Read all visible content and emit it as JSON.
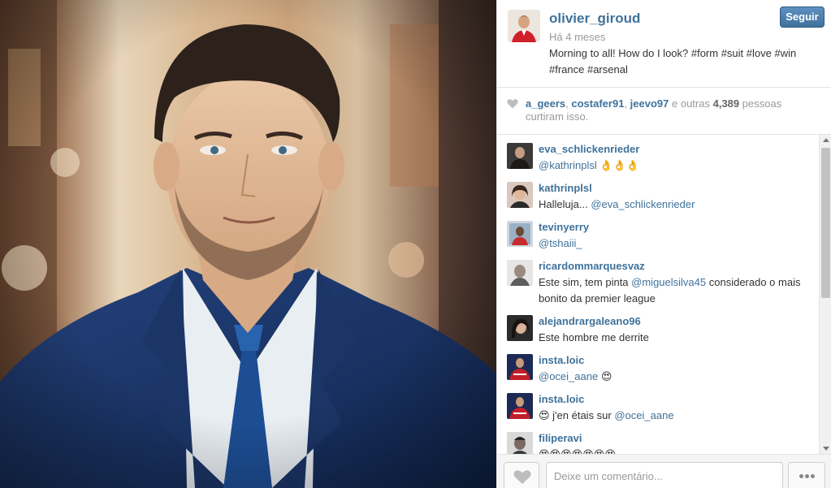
{
  "post": {
    "username": "olivier_giroud",
    "time": "Há 4 meses",
    "caption": "Morning to all! How do I look? #form #suit #love #win #france #arsenal",
    "follow_label": "Seguir"
  },
  "likes": {
    "users": [
      "a_geers",
      "costafer91",
      "jeevo97"
    ],
    "middle_text": "e outras",
    "count": "4,389",
    "tail_text": "pessoas curtiram isso."
  },
  "comments": [
    {
      "user": "eva_schlickenrieder",
      "parts": [
        {
          "t": "@kathrinplsl",
          "m": true
        },
        {
          "t": " 👌👌👌",
          "m": false
        }
      ]
    },
    {
      "user": "kathrinplsl",
      "parts": [
        {
          "t": "Halleluja... ",
          "m": false
        },
        {
          "t": "@eva_schlickenrieder",
          "m": true
        }
      ]
    },
    {
      "user": "tevinyerry",
      "parts": [
        {
          "t": "@tshaiii_",
          "m": true
        }
      ]
    },
    {
      "user": "ricardommarquesvaz",
      "parts": [
        {
          "t": "Este sim, tem pinta ",
          "m": false
        },
        {
          "t": "@miguelsilva45",
          "m": true
        },
        {
          "t": " considerado o mais bonito da premier league",
          "m": false
        }
      ]
    },
    {
      "user": "alejandrargaleano96",
      "parts": [
        {
          "t": "Este hombre me derrite",
          "m": false
        }
      ]
    },
    {
      "user": "insta.loic",
      "parts": [
        {
          "t": "@ocei_aane",
          "m": true
        },
        {
          "t": " 😍",
          "m": false
        }
      ]
    },
    {
      "user": "insta.loic",
      "parts": [
        {
          "t": "😍 j'en étais sur ",
          "m": false
        },
        {
          "t": "@ocei_aane",
          "m": true
        }
      ]
    },
    {
      "user": "filiperavi",
      "parts": [
        {
          "t": "😍😍😍😍😍😍😍",
          "m": false
        }
      ]
    }
  ],
  "footer": {
    "comment_placeholder": "Deixe um comentário..."
  },
  "icons": {
    "like": "heart-icon",
    "more": "more-dots-icon"
  },
  "colors": {
    "link": "#3f729b",
    "follow_button": "#3f729b"
  }
}
